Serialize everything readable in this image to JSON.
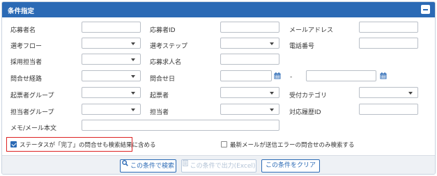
{
  "panel": {
    "title": "条件指定"
  },
  "fields": {
    "applicant_name": "応募者名",
    "applicant_id": "応募者ID",
    "email_address": "メールアドレス",
    "selection_flow": "選考フロー",
    "selection_step": "選考ステップ",
    "phone_number": "電話番号",
    "recruiter": "採用担当者",
    "job_posting": "応募求人名",
    "inquiry_route": "問合せ経路",
    "inquiry_date": "問合せ日",
    "date_separator": "-",
    "ticket_group": "起票者グループ",
    "ticket_creator": "起票者",
    "reception_category": "受付カテゴリ",
    "assignee_group": "担当者グループ",
    "assignee": "担当者",
    "history_id": "対応履歴ID",
    "memo_body": "メモ/メール本文"
  },
  "checkboxes": {
    "include_completed": {
      "label": "ステータスが「完了」の問合せも検索結果に含める",
      "checked": true
    },
    "send_error_only": {
      "label": "最新メールが送信エラーの問合せのみ検索する",
      "checked": false
    }
  },
  "buttons": {
    "search": "この条件で検索",
    "export_excel": "この条件で出力(Excel)",
    "clear": "この条件をクリア"
  },
  "colors": {
    "accent": "#2b6ab5",
    "highlight": "#dd2222"
  }
}
